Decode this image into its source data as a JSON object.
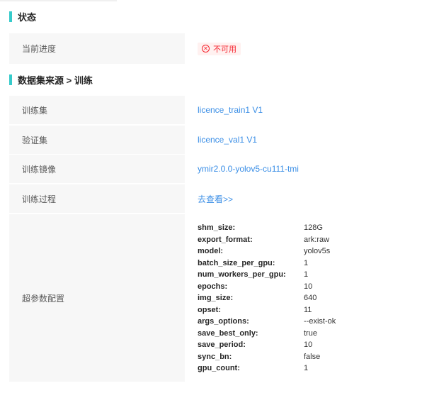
{
  "status_section": {
    "title": "状态",
    "progress_label": "当前进度",
    "progress_tag": "不可用"
  },
  "dataset_section": {
    "title": "数据集来源 > 训练",
    "rows": [
      {
        "label": "训练集",
        "value": "licence_train1 V1"
      },
      {
        "label": "验证集",
        "value": "licence_val1 V1"
      },
      {
        "label": "训练镜像",
        "value": "ymir2.0.0-yolov5-cu111-tmi"
      },
      {
        "label": "训练过程",
        "value": "去查看>>"
      }
    ],
    "hyperparams_label": "超参数配置",
    "hyperparams": [
      {
        "key": "shm_size:",
        "value": "128G"
      },
      {
        "key": "export_format:",
        "value": "ark:raw"
      },
      {
        "key": "model:",
        "value": "yolov5s"
      },
      {
        "key": "batch_size_per_gpu:",
        "value": "1"
      },
      {
        "key": "num_workers_per_gpu:",
        "value": "1"
      },
      {
        "key": "epochs:",
        "value": "10"
      },
      {
        "key": "img_size:",
        "value": "640"
      },
      {
        "key": "opset:",
        "value": "11"
      },
      {
        "key": "args_options:",
        "value": "--exist-ok"
      },
      {
        "key": "save_best_only:",
        "value": "true"
      },
      {
        "key": "save_period:",
        "value": "10"
      },
      {
        "key": "sync_bn:",
        "value": "false"
      },
      {
        "key": "gpu_count:",
        "value": "1"
      }
    ]
  },
  "colors": {
    "accent_bar": "#36cbcb",
    "link": "#3a8ee6",
    "error": "#f5222d",
    "label_bg": "#f7f7f7"
  }
}
